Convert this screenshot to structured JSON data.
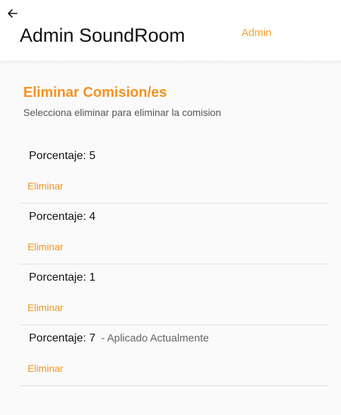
{
  "header": {
    "back_icon": "arrow-left-icon",
    "title": "Admin SoundRoom",
    "role": "Admin"
  },
  "section": {
    "title": "Eliminar Comision/es",
    "subtitle": "Selecciona eliminar para eliminar la comision"
  },
  "commissions": [
    {
      "label": "Porcentaje: 5",
      "note": "",
      "action": "Eliminar"
    },
    {
      "label": "Porcentaje: 4",
      "note": "",
      "action": "Eliminar"
    },
    {
      "label": "Porcentaje: 1",
      "note": "",
      "action": "Eliminar"
    },
    {
      "label": "Porcentaje: 7",
      "note": "- Aplicado Actualmente",
      "action": "Eliminar"
    }
  ],
  "colors": {
    "accent": "#f39321",
    "header_role": "#f5a02a",
    "background": "#fafafa"
  }
}
